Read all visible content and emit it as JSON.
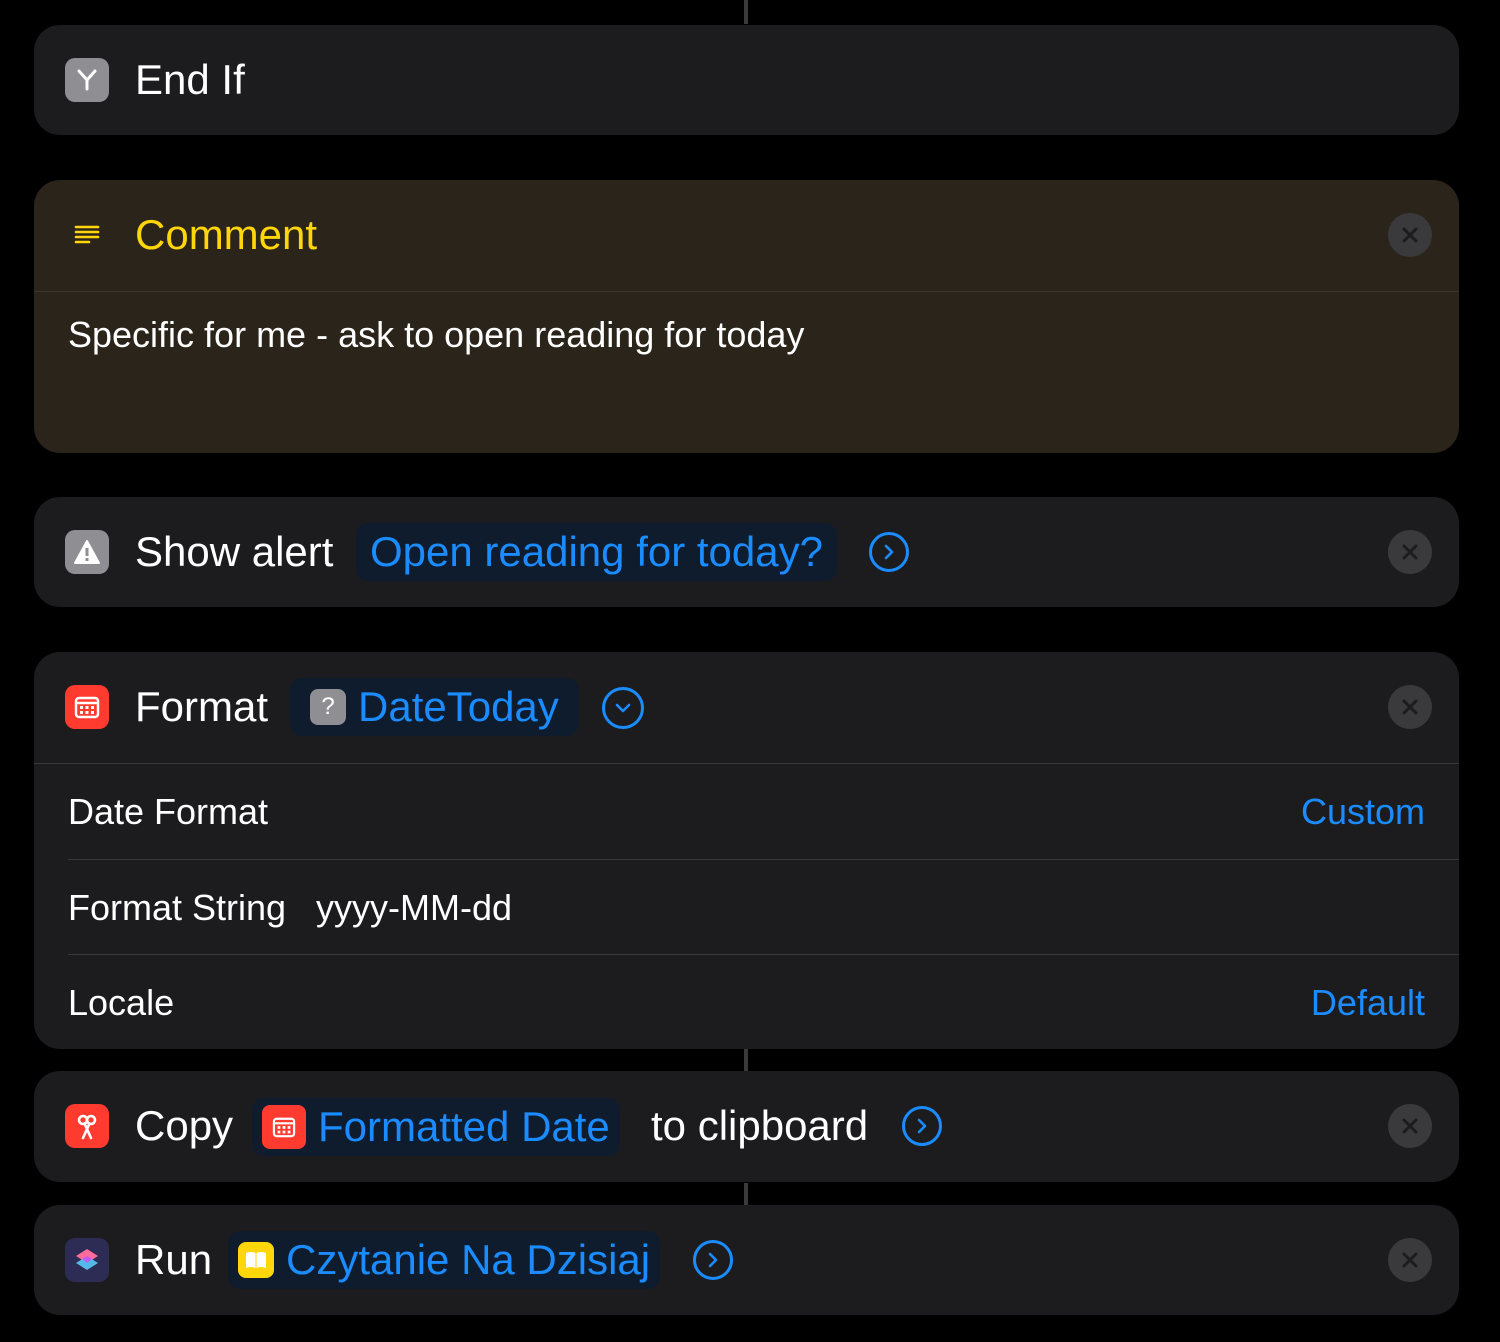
{
  "end_if": {
    "label": "End If"
  },
  "comment": {
    "title": "Comment",
    "text": "Specific for me - ask to open reading for today"
  },
  "show_alert": {
    "label": "Show alert",
    "message": "Open reading for today?"
  },
  "format_date": {
    "label": "Format",
    "variable": "DateToday",
    "rows": {
      "date_format": {
        "label": "Date Format",
        "value": "Custom"
      },
      "format_string": {
        "label": "Format String",
        "value": "yyyy-MM-dd"
      },
      "locale": {
        "label": "Locale",
        "value": "Default"
      }
    }
  },
  "copy": {
    "label": "Copy",
    "variable": "Formatted Date",
    "suffix": "to clipboard"
  },
  "run": {
    "label": "Run",
    "shortcut": "Czytanie Na Dzisiaj"
  },
  "colors": {
    "accent_blue": "#1a8cff",
    "comment_yellow": "#ffd60a",
    "calendar_red": "#ff3b30",
    "card_bg": "#1c1c1e",
    "comment_bg": "#2a241a"
  }
}
